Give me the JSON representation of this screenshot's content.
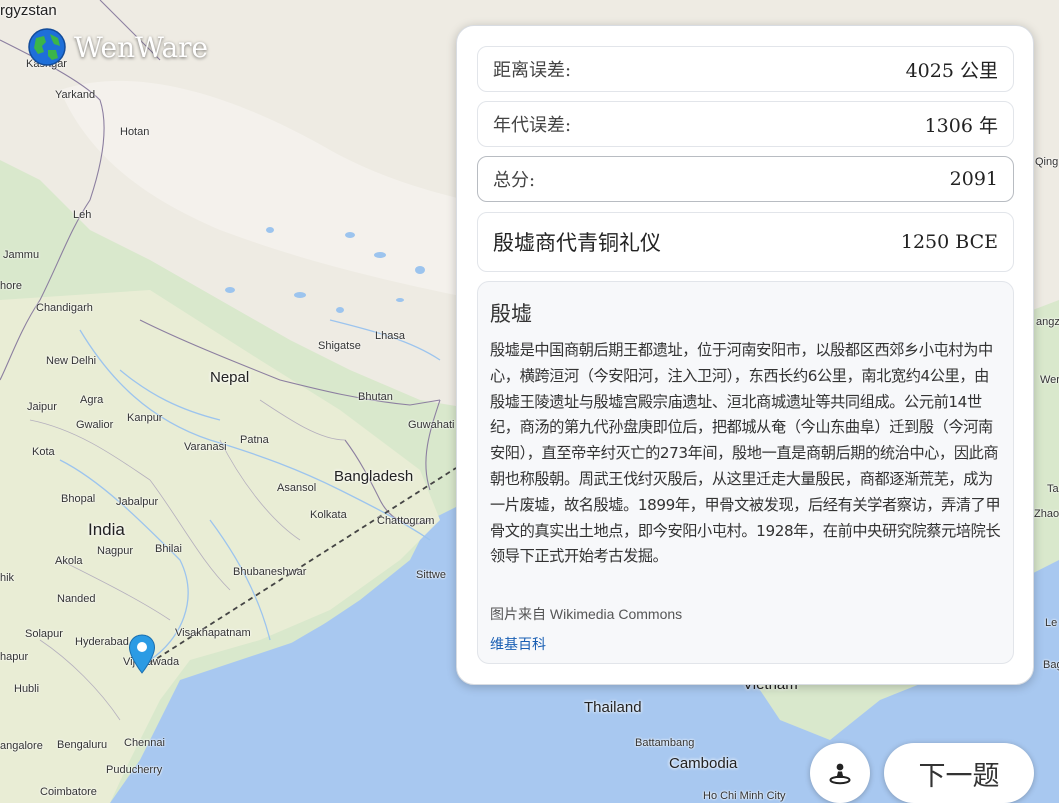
{
  "app": {
    "name": "WenWare"
  },
  "map": {
    "cities": [
      "Kashgar",
      "Yarkand",
      "Hotan",
      "Leh",
      "Jammu",
      "Lahore",
      "Chandigarh",
      "New Delhi",
      "Jaipur",
      "Gwalior",
      "Kanpur",
      "Agra",
      "Varanasi",
      "Patna",
      "Kota",
      "Bhopal",
      "Jabalpur",
      "Nagpur",
      "Bhilai",
      "Akola",
      "Nanded",
      "Solapur",
      "Hyderabad",
      "Vijayawada",
      "Visakhapatnam",
      "Bhubaneshwar",
      "Kolkata",
      "Asansol",
      "Chattogram",
      "Sittwe",
      "Shigatse",
      "Lhasa",
      "Bhutan",
      "Guwahati",
      "Hubli",
      "Bengaluru",
      "Chennai",
      "Puducherry",
      "Coimbatore",
      "Battambang",
      "Ho Chi Minh City",
      "Qing",
      "Wer",
      "Ta",
      "Zhaos",
      "angz",
      "Bag",
      "Le"
    ],
    "countries": [
      "rgyzstan",
      "Nepal",
      "Bangladesh",
      "India",
      "Thailand",
      "Vietnam",
      "Cambodia"
    ],
    "cut_labels": [
      "hore",
      "hik",
      "hapur",
      "angalore",
      "ngaluru"
    ]
  },
  "result": {
    "distance_label": "距离误差:",
    "distance_value": "4025 公里",
    "year_label": "年代误差:",
    "year_value": "1306 年",
    "total_label": "总分:",
    "total_value": "2091",
    "item_title": "殷墟商代青铜礼仪",
    "item_date": "1250 BCE"
  },
  "info": {
    "title": "殷墟",
    "text": "殷墟是中国商朝后期王都遗址，位于河南安阳市，以殷都区西郊乡小屯村为中心，横跨洹河（今安阳河，注入卫河），东西长约6公里，南北宽约4公里，由殷墟王陵遗址与殷墟宫殿宗庙遗址、洹北商城遗址等共同组成。公元前14世纪，商汤的第九代孙盘庚即位后，把都城从奄（今山东曲阜）迁到殷（今河南安阳），直至帝辛纣灭亡的273年间，殷地一直是商朝后期的统治中心，因此商朝也称殷朝。周武王伐纣灭殷后，从这里迁走大量殷民，商都逐渐荒芜，成为一片废墟，故名殷墟。1899年，甲骨文被发现，后经有关学者察访，弄清了甲骨文的真实出土地点，即今安阳小屯村。1928年，在前中央研究院蔡元培院长领导下正式开始考古发掘。",
    "credit": "图片来自 Wikimedia Commons",
    "wiki_link": "维基百科"
  },
  "buttons": {
    "next_label": "下一题",
    "recenter_icon": "person-pin-icon"
  },
  "colors": {
    "water": "#a8c8f0",
    "land": "#efeae0",
    "mountain": "#e6e2d6",
    "green": "#cfe3c3",
    "marker": "#2b9be4",
    "link": "#1a5fb4"
  }
}
